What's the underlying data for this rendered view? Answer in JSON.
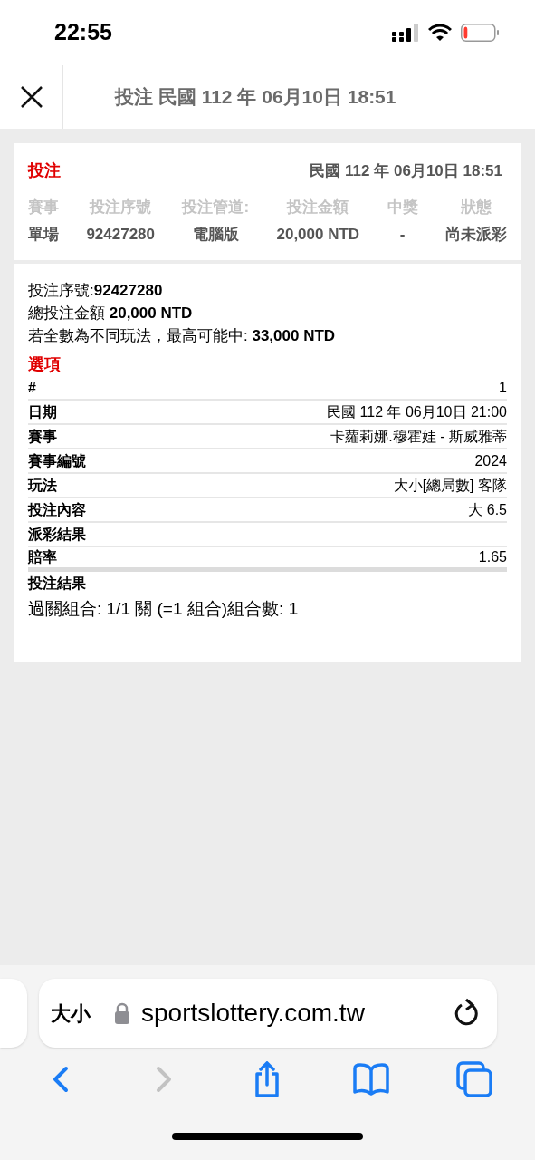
{
  "status_bar": {
    "time": "22:55"
  },
  "header": {
    "title": "投注 民國 112 年 06月10日 18:51"
  },
  "summary": {
    "title": "投注",
    "datetime": "民國 112 年 06月10日 18:51",
    "columns": [
      {
        "label": "賽事",
        "value": "單場"
      },
      {
        "label": "投注序號",
        "value": "92427280"
      },
      {
        "label": "投注管道:",
        "value": "電腦版"
      },
      {
        "label": "投注金額",
        "value": "20,000 NTD"
      },
      {
        "label": "中獎",
        "value": "-"
      },
      {
        "label": "狀態",
        "value": "尚未派彩"
      }
    ]
  },
  "details": {
    "lines": [
      "投注序號:**92427280**",
      "總投注金額 **20,000 NTD**",
      "若全數為不同玩法，最高可能中: **33,000 NTD**"
    ],
    "options_title": "選項",
    "rows": [
      {
        "label": "#",
        "value": "1"
      },
      {
        "label": "日期",
        "value": "民國 112 年 06月10日 21:00"
      },
      {
        "label": "賽事",
        "value": "卡蘿莉娜.穆霍娃 - 斯威雅蒂"
      },
      {
        "label": "賽事編號",
        "value": "2024"
      },
      {
        "label": "玩法",
        "value": "大小[總局數] 客隊"
      },
      {
        "label": "投注內容",
        "value": "大 6.5"
      },
      {
        "label": "派彩結果"
      },
      {
        "label": "賠率",
        "value": "1.65"
      }
    ],
    "result_title": "投注結果",
    "result_text": "過關組合: 1/1 關 (=1 組合)組合數: 1"
  },
  "browser": {
    "text_size": "大小",
    "url": "sportslottery.com.tw",
    "toolbar": [
      {
        "kind": "back",
        "disabled": false
      },
      {
        "kind": "forward",
        "disabled": true
      },
      {
        "kind": "share",
        "disabled": false
      },
      {
        "kind": "bookmarks",
        "disabled": false
      },
      {
        "kind": "tabs",
        "disabled": false
      }
    ]
  }
}
